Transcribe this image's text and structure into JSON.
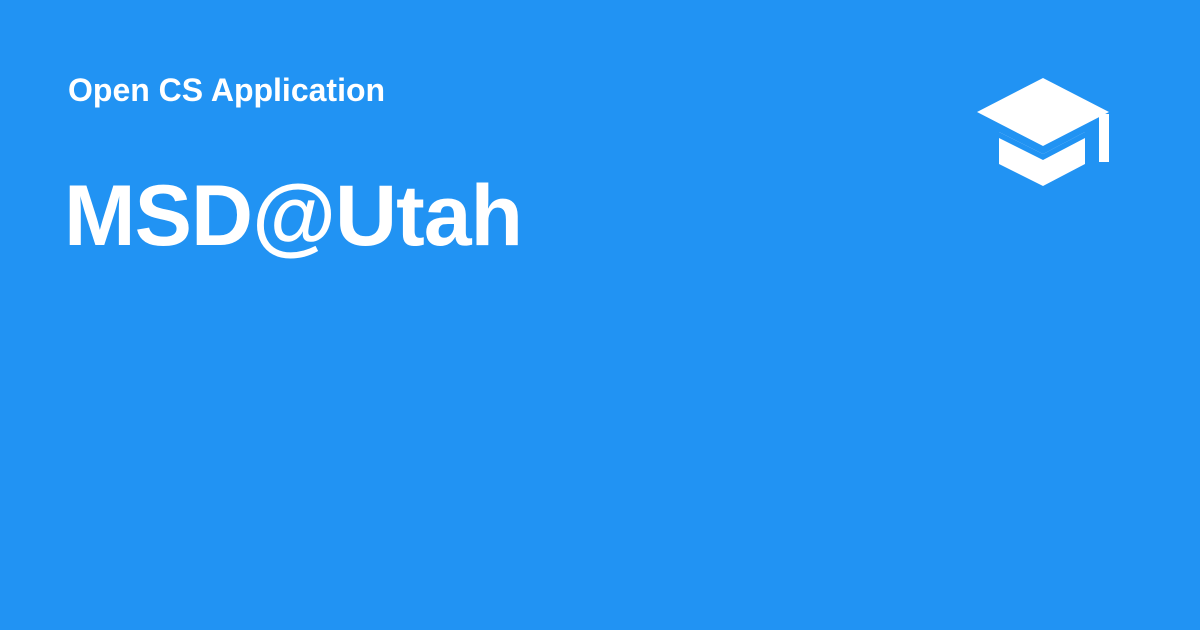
{
  "theme": {
    "background": "#2193f3",
    "foreground": "#ffffff"
  },
  "header": {
    "subtitle": "Open CS Application",
    "title": "MSD@Utah"
  },
  "icons": {
    "logo": "graduation-cap-icon"
  }
}
